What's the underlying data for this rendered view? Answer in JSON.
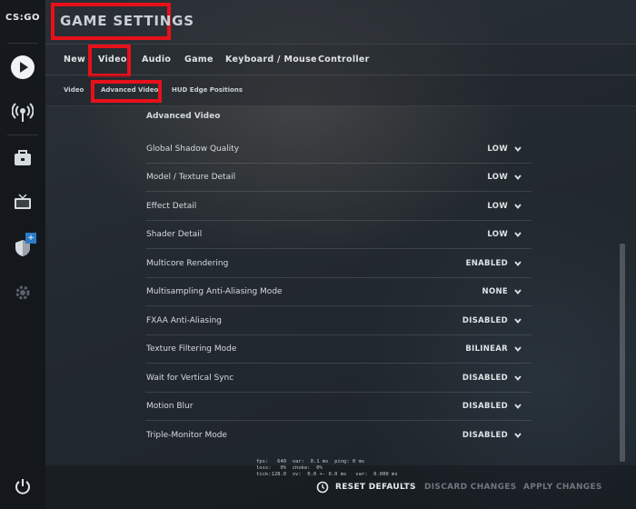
{
  "app": {
    "logo": "CS:GO"
  },
  "header": {
    "title": "GAME SETTINGS"
  },
  "sidebar": {
    "icons": [
      "play-icon",
      "broadcast-icon",
      "inventory-icon",
      "tv-icon",
      "shield-icon",
      "settings-icon",
      "power-icon"
    ],
    "badge": "+"
  },
  "tabs": [
    {
      "label": "New"
    },
    {
      "label": "Video"
    },
    {
      "label": "Audio"
    },
    {
      "label": "Game"
    },
    {
      "label": "Keyboard / Mouse"
    },
    {
      "label": "Controller"
    }
  ],
  "active_tab": "Video",
  "subtabs": [
    {
      "label": "Video"
    },
    {
      "label": "Advanced Video"
    },
    {
      "label": "HUD Edge Positions"
    }
  ],
  "active_subtab": "Advanced Video",
  "section": {
    "title": "Advanced Video"
  },
  "settings": [
    {
      "label": "Global Shadow Quality",
      "value": "LOW"
    },
    {
      "label": "Model / Texture Detail",
      "value": "LOW"
    },
    {
      "label": "Effect Detail",
      "value": "LOW"
    },
    {
      "label": "Shader Detail",
      "value": "LOW"
    },
    {
      "label": "Multicore Rendering",
      "value": "ENABLED"
    },
    {
      "label": "Multisampling Anti-Aliasing Mode",
      "value": "NONE"
    },
    {
      "label": "FXAA Anti-Aliasing",
      "value": "DISABLED"
    },
    {
      "label": "Texture Filtering Mode",
      "value": "BILINEAR"
    },
    {
      "label": "Wait for Vertical Sync",
      "value": "DISABLED"
    },
    {
      "label": "Motion Blur",
      "value": "DISABLED"
    },
    {
      "label": "Triple-Monitor Mode",
      "value": "DISABLED"
    }
  ],
  "netgraph": {
    "line1": "fps:   640  var:  0.1 ms  ping: 0 ms",
    "line2": "loss:   0%  choke:  0%",
    "line3": "tick:128.0  sv:  0.0 +- 0.0 ms   var:  0.000 ms"
  },
  "footer": {
    "reset_label": "RESET DEFAULTS",
    "discard_label": "DISCARD CHANGES",
    "apply_label": "APPLY CHANGES"
  },
  "colors": {
    "highlight": "#e8101a",
    "badge": "#2d7ac4"
  }
}
